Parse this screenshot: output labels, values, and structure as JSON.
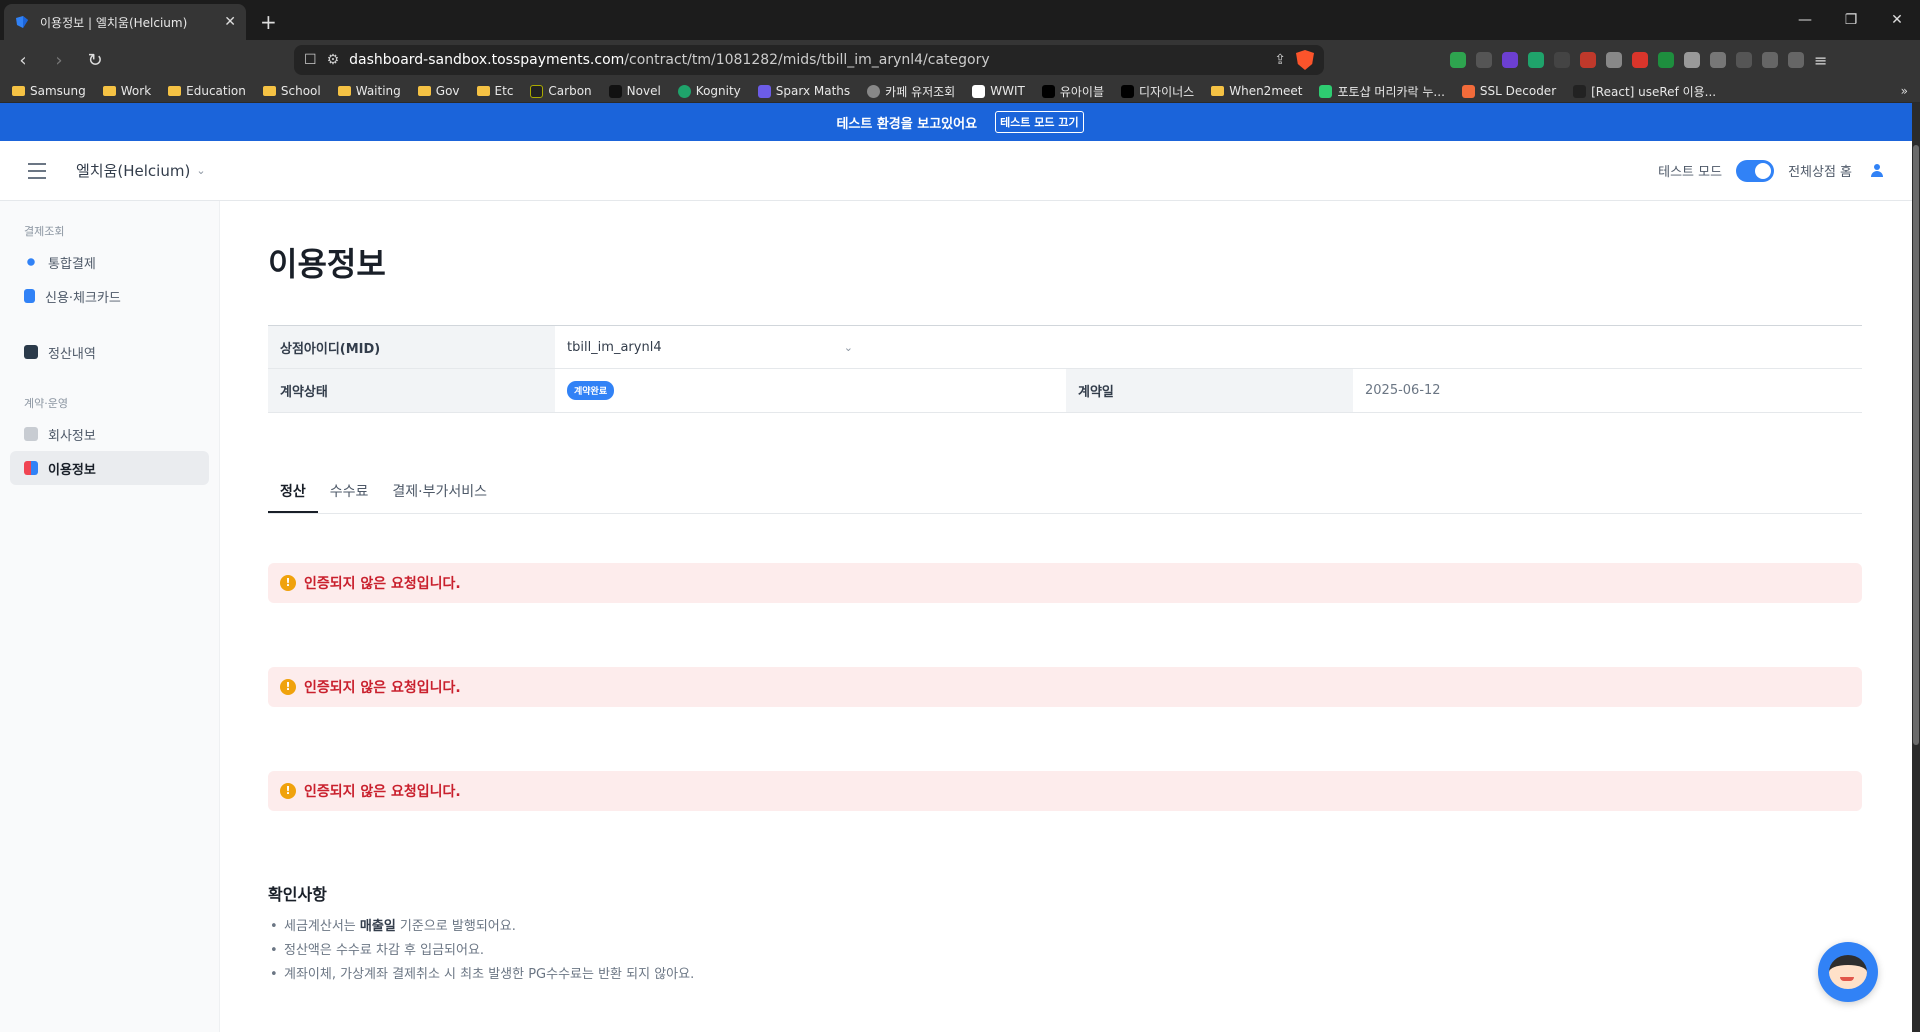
{
  "browser": {
    "tab_title": "이용정보 | 엘치움(Helcium)",
    "url_host": "dashboard-sandbox.tosspayments.com",
    "url_path": "/contract/tm/1081282/mids/tbill_im_arynl4/category",
    "bookmarks": [
      "Samsung",
      "Work",
      "Education",
      "School",
      "Waiting",
      "Gov",
      "Etc",
      "Carbon",
      "Novel",
      "Kognity",
      "Sparx Maths",
      "카페 유저조회",
      "WWIT",
      "유아이블",
      "디자이너스",
      "When2meet",
      "포토샵 머리카락 누...",
      "SSL Decoder",
      "[React] useRef 이용..."
    ]
  },
  "testbar": {
    "message": "테스트 환경을 보고있어요",
    "button": "테스트 모드 끄기"
  },
  "header": {
    "shop_name": "엘치움(Helcium)",
    "test_mode_label": "테스트 모드",
    "store_home_label": "전체상점 홈"
  },
  "sidebar": {
    "group1": "결제조회",
    "item_integrated": "통합결제",
    "item_card": "신용·체크카드",
    "item_settlement": "정산내역",
    "group2": "계약·운영",
    "item_company": "회사정보",
    "item_usage": "이용정보"
  },
  "main": {
    "title": "이용정보",
    "mid_label": "상점아이디(MID)",
    "mid_value": "tbill_im_arynl4",
    "status_label": "계약상태",
    "status_badge": "계약완료",
    "date_label": "계약일",
    "date_value": "2025-06-12",
    "tabs": [
      "정산",
      "수수료",
      "결제·부가서비스"
    ],
    "alerts": [
      "인증되지 않은 요청입니다.",
      "인증되지 않은 요청입니다.",
      "인증되지 않은 요청입니다."
    ],
    "notice_title": "확인사항",
    "notice1_pre": "세금계산서는 ",
    "notice1_bold": "매출일",
    "notice1_post": " 기준으로 발행되어요.",
    "notice2": "정산액은 수수료 차감 후 입금되어요.",
    "notice3": "계좌이체, 가상계좌 결제취소 시 최초 발생한 PG수수료는 반환 되지 않아요."
  }
}
